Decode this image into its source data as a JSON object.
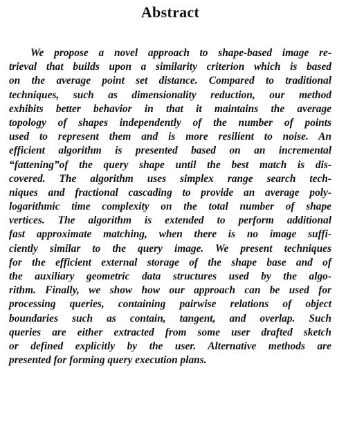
{
  "heading": "Abstract",
  "lines": [
    "We propose a novel approach to shape-based image re-",
    "trieval that builds upon a similarity criterion which is based",
    "on the average point set distance. Compared to traditional",
    "techniques, such as dimensionality reduction, our method",
    "exhibits better behavior in that it maintains the average",
    "topology of shapes independently of the number of points",
    "used to represent them and is more resilient to noise. An",
    "efficient algorithm is presented based on an incremental",
    "“fattening”of the query shape until the best match is dis-",
    "covered. The algorithm uses simplex range search tech-",
    "niques and fractional cascading to provide an average poly-",
    "logarithmic time complexity on the total number of shape",
    "vertices. The algorithm is extended to perform additional",
    "fast approximate matching, when there is no image suffi-",
    "ciently similar to the query image. We present techniques",
    "for the efficient external storage of the shape base and of",
    "the auxiliary geometric data structures used by the algo-",
    "rithm. Finally, we show how our approach can be used for",
    "processing queries, containing pairwise relations of object",
    "boundaries such as contain, tangent, and overlap. Such",
    "queries are either extracted from some user drafted sketch",
    "or defined explicitly by the user. Alternative methods are",
    "presented for forming query execution plans."
  ]
}
